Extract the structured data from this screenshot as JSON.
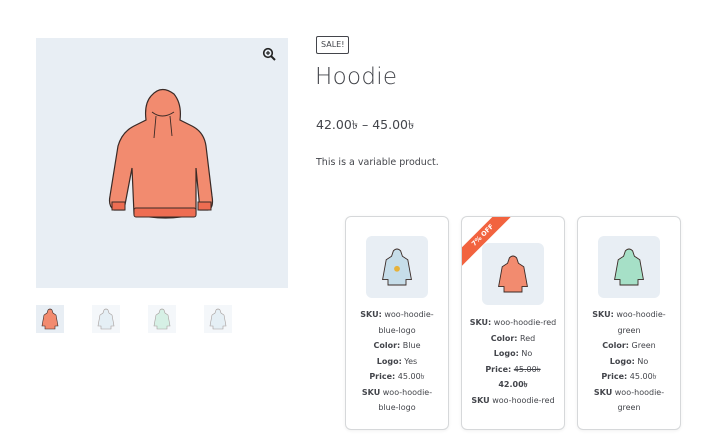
{
  "colors": {
    "hoodie_red": "#f28b6f",
    "hoodie_blue": "#c6dde9",
    "hoodie_green": "#a6e0c7",
    "sale_ribbon": "#f2633f",
    "text": "#43454b",
    "image_bg": "#e8eef4"
  },
  "gallery": {
    "zoom_icon": "magnifier-plus-icon",
    "thumbnails": [
      {
        "color": "red",
        "active": true
      },
      {
        "color": "blue",
        "active": false
      },
      {
        "color": "green",
        "active": false
      },
      {
        "color": "blue",
        "active": false
      }
    ]
  },
  "product": {
    "sale_badge": "SALE!",
    "title": "Hoodie",
    "price_range": "42.00৳ – 45.00৳",
    "description": "This is a variable product."
  },
  "variations": [
    {
      "sku_label": "SKU:",
      "sku_line1": " woo-hoodie-",
      "sku_line2": "blue-logo",
      "color_label": "Color:",
      "color_value": " Blue",
      "logo_label": "Logo:",
      "logo_value": " Yes",
      "price_label": "Price:",
      "price_value": " 45.00৳",
      "sku_bottom_label": "SKU",
      "sku_bottom_line1": " woo-hoodie-",
      "sku_bottom_line2": "blue-logo"
    },
    {
      "ribbon": "7% OFF",
      "sku_label": "SKU:",
      "sku_line1": " woo-hoodie-red",
      "color_label": "Color:",
      "color_value": " Red",
      "logo_label": "Logo:",
      "logo_value": " No",
      "price_label": "Price:",
      "old_price": "45.00৳",
      "new_price": "42.00৳",
      "sku_bottom_label": "SKU",
      "sku_bottom_line1": " woo-hoodie-red"
    },
    {
      "sku_label": "SKU:",
      "sku_line1": " woo-hoodie-",
      "sku_line2": "green",
      "color_label": "Color:",
      "color_value": " Green",
      "logo_label": "Logo:",
      "logo_value": " No",
      "price_label": "Price:",
      "price_value": " 45.00৳",
      "sku_bottom_label": "SKU",
      "sku_bottom_line1": " woo-hoodie-",
      "sku_bottom_line2": "green"
    }
  ]
}
